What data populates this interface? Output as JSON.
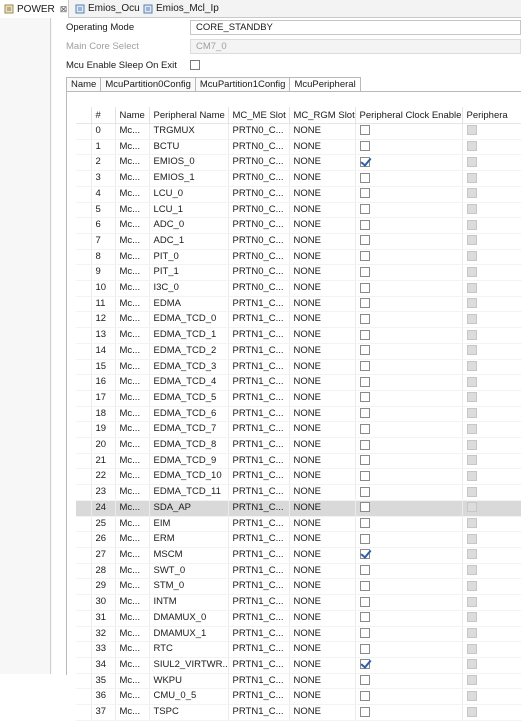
{
  "tabs": [
    {
      "label": "POWER",
      "close": "⊠"
    },
    {
      "label": "Emios_Ocu"
    },
    {
      "label": "Emios_Mcl_Ip"
    }
  ],
  "form": {
    "operating_mode_label": "Operating Mode",
    "operating_mode_value": "CORE_STANDBY",
    "main_core_label": "Main Core Select",
    "main_core_value": "CM7_0",
    "sleep_label": "Mcu Enable Sleep On Exit"
  },
  "subtabs": [
    "Name",
    "McuPartition0Config",
    "McuPartition1Config",
    "McuPeripheral"
  ],
  "columns": [
    "#",
    "Name",
    "Peripheral Name",
    "MC_ME Slot",
    "MC_RGM Slot",
    "Peripheral Clock Enable",
    "Periphera"
  ],
  "rows": [
    {
      "n": "0",
      "name": "Mc...",
      "peripheral": "TRGMUX",
      "me": "PRTN0_C...",
      "rgm": "NONE",
      "clk": false
    },
    {
      "n": "1",
      "name": "Mc...",
      "peripheral": "BCTU",
      "me": "PRTN0_C...",
      "rgm": "NONE",
      "clk": false
    },
    {
      "n": "2",
      "name": "Mc...",
      "peripheral": "EMIOS_0",
      "me": "PRTN0_C...",
      "rgm": "NONE",
      "clk": true
    },
    {
      "n": "3",
      "name": "Mc...",
      "peripheral": "EMIOS_1",
      "me": "PRTN0_C...",
      "rgm": "NONE",
      "clk": false
    },
    {
      "n": "4",
      "name": "Mc...",
      "peripheral": "LCU_0",
      "me": "PRTN0_C...",
      "rgm": "NONE",
      "clk": false
    },
    {
      "n": "5",
      "name": "Mc...",
      "peripheral": "LCU_1",
      "me": "PRTN0_C...",
      "rgm": "NONE",
      "clk": false
    },
    {
      "n": "6",
      "name": "Mc...",
      "peripheral": "ADC_0",
      "me": "PRTN0_C...",
      "rgm": "NONE",
      "clk": false
    },
    {
      "n": "7",
      "name": "Mc...",
      "peripheral": "ADC_1",
      "me": "PRTN0_C...",
      "rgm": "NONE",
      "clk": false
    },
    {
      "n": "8",
      "name": "Mc...",
      "peripheral": "PIT_0",
      "me": "PRTN0_C...",
      "rgm": "NONE",
      "clk": false
    },
    {
      "n": "9",
      "name": "Mc...",
      "peripheral": "PIT_1",
      "me": "PRTN0_C...",
      "rgm": "NONE",
      "clk": false
    },
    {
      "n": "10",
      "name": "Mc...",
      "peripheral": "I3C_0",
      "me": "PRTN0_C...",
      "rgm": "NONE",
      "clk": false
    },
    {
      "n": "11",
      "name": "Mc...",
      "peripheral": "EDMA",
      "me": "PRTN1_C...",
      "rgm": "NONE",
      "clk": false
    },
    {
      "n": "12",
      "name": "Mc...",
      "peripheral": "EDMA_TCD_0",
      "me": "PRTN1_C...",
      "rgm": "NONE",
      "clk": false
    },
    {
      "n": "13",
      "name": "Mc...",
      "peripheral": "EDMA_TCD_1",
      "me": "PRTN1_C...",
      "rgm": "NONE",
      "clk": false
    },
    {
      "n": "14",
      "name": "Mc...",
      "peripheral": "EDMA_TCD_2",
      "me": "PRTN1_C...",
      "rgm": "NONE",
      "clk": false
    },
    {
      "n": "15",
      "name": "Mc...",
      "peripheral": "EDMA_TCD_3",
      "me": "PRTN1_C...",
      "rgm": "NONE",
      "clk": false
    },
    {
      "n": "16",
      "name": "Mc...",
      "peripheral": "EDMA_TCD_4",
      "me": "PRTN1_C...",
      "rgm": "NONE",
      "clk": false
    },
    {
      "n": "17",
      "name": "Mc...",
      "peripheral": "EDMA_TCD_5",
      "me": "PRTN1_C...",
      "rgm": "NONE",
      "clk": false
    },
    {
      "n": "18",
      "name": "Mc...",
      "peripheral": "EDMA_TCD_6",
      "me": "PRTN1_C...",
      "rgm": "NONE",
      "clk": false
    },
    {
      "n": "19",
      "name": "Mc...",
      "peripheral": "EDMA_TCD_7",
      "me": "PRTN1_C...",
      "rgm": "NONE",
      "clk": false
    },
    {
      "n": "20",
      "name": "Mc...",
      "peripheral": "EDMA_TCD_8",
      "me": "PRTN1_C...",
      "rgm": "NONE",
      "clk": false
    },
    {
      "n": "21",
      "name": "Mc...",
      "peripheral": "EDMA_TCD_9",
      "me": "PRTN1_C...",
      "rgm": "NONE",
      "clk": false
    },
    {
      "n": "22",
      "name": "Mc...",
      "peripheral": "EDMA_TCD_10",
      "me": "PRTN1_C...",
      "rgm": "NONE",
      "clk": false
    },
    {
      "n": "23",
      "name": "Mc...",
      "peripheral": "EDMA_TCD_11",
      "me": "PRTN1_C...",
      "rgm": "NONE",
      "clk": false
    },
    {
      "n": "24",
      "name": "Mc...",
      "peripheral": "SDA_AP",
      "me": "PRTN1_C...",
      "rgm": "NONE",
      "clk": false,
      "selected": true
    },
    {
      "n": "25",
      "name": "Mc...",
      "peripheral": "EIM",
      "me": "PRTN1_C...",
      "rgm": "NONE",
      "clk": false
    },
    {
      "n": "26",
      "name": "Mc...",
      "peripheral": "ERM",
      "me": "PRTN1_C...",
      "rgm": "NONE",
      "clk": false
    },
    {
      "n": "27",
      "name": "Mc...",
      "peripheral": "MSCM",
      "me": "PRTN1_C...",
      "rgm": "NONE",
      "clk": true
    },
    {
      "n": "28",
      "name": "Mc...",
      "peripheral": "SWT_0",
      "me": "PRTN1_C...",
      "rgm": "NONE",
      "clk": false
    },
    {
      "n": "29",
      "name": "Mc...",
      "peripheral": "STM_0",
      "me": "PRTN1_C...",
      "rgm": "NONE",
      "clk": false
    },
    {
      "n": "30",
      "name": "Mc...",
      "peripheral": "INTM",
      "me": "PRTN1_C...",
      "rgm": "NONE",
      "clk": false
    },
    {
      "n": "31",
      "name": "Mc...",
      "peripheral": "DMAMUX_0",
      "me": "PRTN1_C...",
      "rgm": "NONE",
      "clk": false
    },
    {
      "n": "32",
      "name": "Mc...",
      "peripheral": "DMAMUX_1",
      "me": "PRTN1_C...",
      "rgm": "NONE",
      "clk": false
    },
    {
      "n": "33",
      "name": "Mc...",
      "peripheral": "RTC",
      "me": "PRTN1_C...",
      "rgm": "NONE",
      "clk": false
    },
    {
      "n": "34",
      "name": "Mc...",
      "peripheral": "SIUL2_VIRTWR...",
      "me": "PRTN1_C...",
      "rgm": "NONE",
      "clk": true
    },
    {
      "n": "35",
      "name": "Mc...",
      "peripheral": "WKPU",
      "me": "PRTN1_C...",
      "rgm": "NONE",
      "clk": false
    },
    {
      "n": "36",
      "name": "Mc...",
      "peripheral": "CMU_0_5",
      "me": "PRTN1_C...",
      "rgm": "NONE",
      "clk": false
    },
    {
      "n": "37",
      "name": "Mc...",
      "peripheral": "TSPC",
      "me": "PRTN1_C...",
      "rgm": "NONE",
      "clk": false
    }
  ]
}
